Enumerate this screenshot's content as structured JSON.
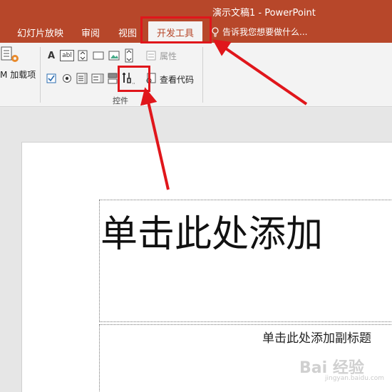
{
  "window": {
    "title": "演示文稿1 - PowerPoint"
  },
  "tabs": [
    {
      "label": "幻灯片放映"
    },
    {
      "label": "审阅"
    },
    {
      "label": "视图"
    },
    {
      "label": "开发工具",
      "active": true
    }
  ],
  "tellme": {
    "label": "告诉我您想要做什么..."
  },
  "ribbon": {
    "addins": {
      "label": "加载项",
      "prefix": "M"
    },
    "properties_label": "属性",
    "view_code_label": "查看代码",
    "controls_group_label": "控件",
    "label_control_glyph": "A",
    "textbox_glyph": "abl"
  },
  "slide": {
    "title_placeholder": "单击此处添加",
    "subtitle_placeholder": "单击此处添加副标题"
  },
  "watermark": {
    "text": "Bai 经验",
    "sub": "jingyan.baidu.com"
  },
  "colors": {
    "accent": "#b7472a",
    "highlight": "#e0161b"
  }
}
